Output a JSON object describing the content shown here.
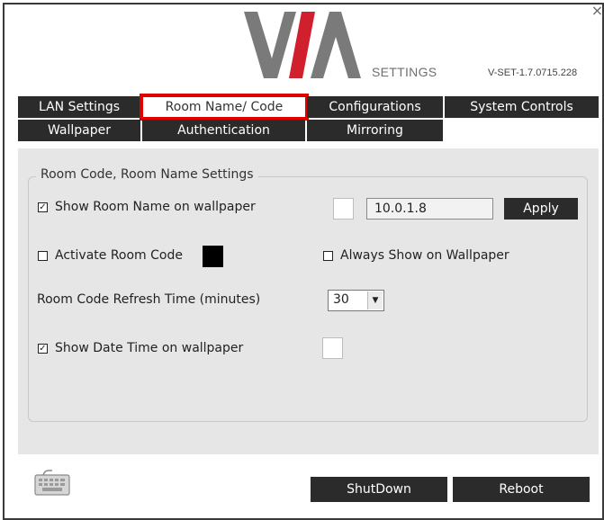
{
  "header": {
    "settings_label": "SETTINGS",
    "version": "V-SET-1.7.0715.228",
    "close_glyph": "×",
    "brand_colors": {
      "gray": "#7a7a7a",
      "red": "#d0202e"
    }
  },
  "tabs": [
    {
      "label": "LAN Settings",
      "active": false
    },
    {
      "label": "Room Name/ Code",
      "active": true
    },
    {
      "label": "Configurations",
      "active": false
    },
    {
      "label": "System Controls",
      "active": false
    },
    {
      "label": "Wallpaper",
      "active": false
    },
    {
      "label": "Authentication",
      "active": false
    },
    {
      "label": "Mirroring",
      "active": false
    }
  ],
  "room_settings": {
    "group_title": "Room Code, Room Name Settings",
    "show_room_name": {
      "label": "Show Room Name on wallpaper",
      "checked": true,
      "check_glyph": "✓"
    },
    "room_name_value": "10.0.1.8",
    "apply_label": "Apply",
    "activate_room_code": {
      "label": "Activate Room Code",
      "checked": false
    },
    "always_show": {
      "label": "Always Show on Wallpaper",
      "checked": false
    },
    "refresh_time": {
      "label": "Room Code Refresh Time (minutes)",
      "value": "30",
      "arrow": "▼"
    },
    "show_date_time": {
      "label": "Show Date Time on wallpaper",
      "checked": true,
      "check_glyph": "✓"
    }
  },
  "footer": {
    "shutdown_label": "ShutDown",
    "reboot_label": "Reboot",
    "keyboard_icon": "keyboard-icon"
  },
  "colors": {
    "tab_background": "#2b2b2b",
    "active_tab_border": "#e00000",
    "panel_background": "#e6e6e6"
  }
}
